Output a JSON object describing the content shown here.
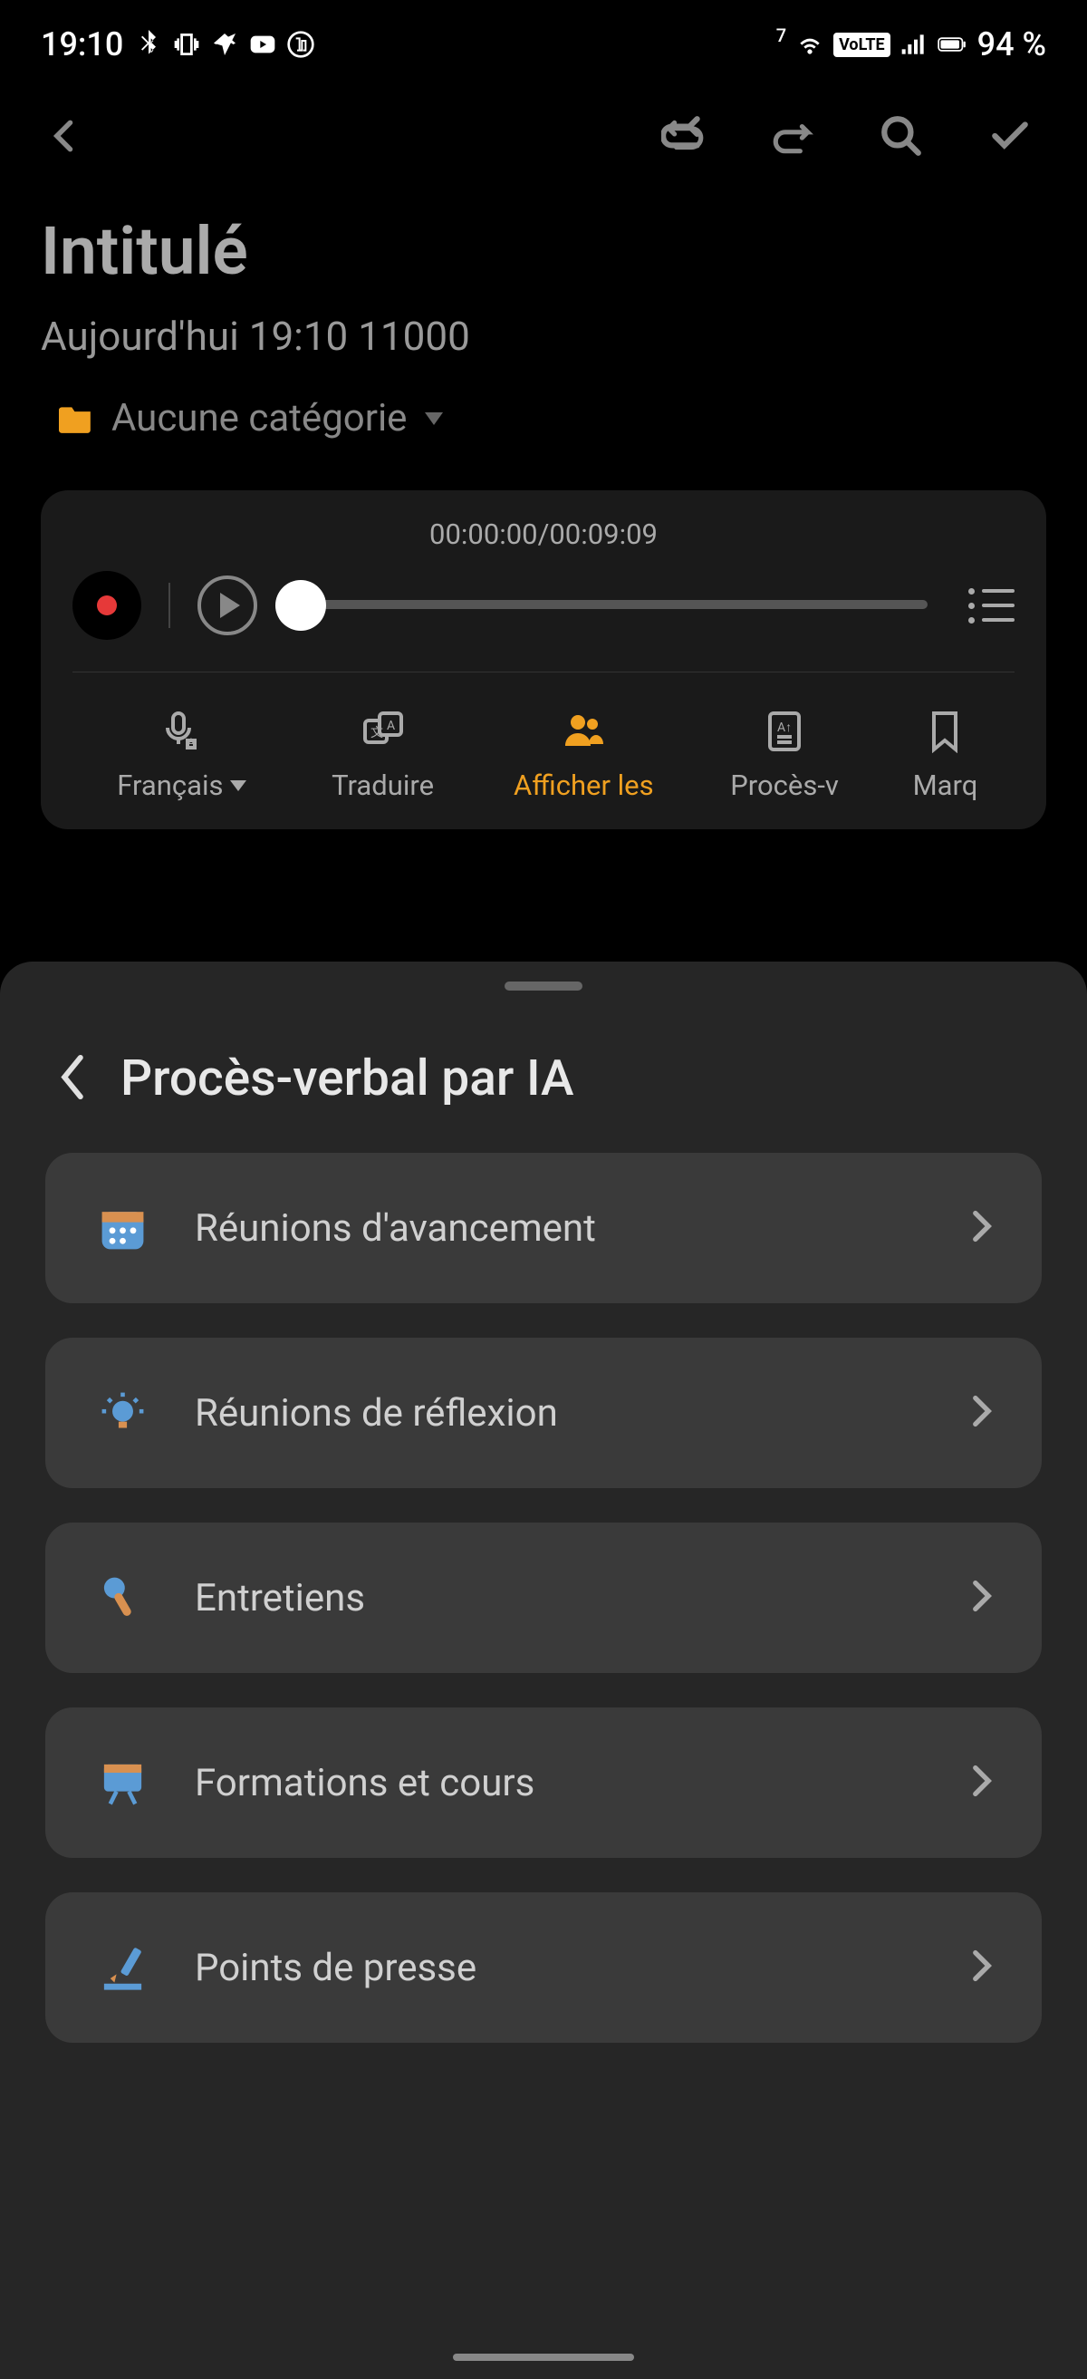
{
  "status": {
    "time": "19:10",
    "battery": "94 %",
    "volte": "VoLTE"
  },
  "header": {
    "title": "Intitulé",
    "subtitle": "Aujourd'hui 19:10  11000",
    "category": "Aucune catégorie"
  },
  "player": {
    "timestamp": "00:00:00/00:09:09"
  },
  "toolbar": {
    "items": [
      {
        "label": "Français"
      },
      {
        "label": "Traduire"
      },
      {
        "label": "Afficher les"
      },
      {
        "label": "Procès-v"
      },
      {
        "label": "Marq"
      }
    ]
  },
  "sheet": {
    "title": "Procès-verbal par IA",
    "options": [
      {
        "label": "Réunions d'avancement"
      },
      {
        "label": "Réunions de réflexion"
      },
      {
        "label": "Entretiens"
      },
      {
        "label": "Formations et cours"
      },
      {
        "label": "Points de presse"
      }
    ]
  }
}
